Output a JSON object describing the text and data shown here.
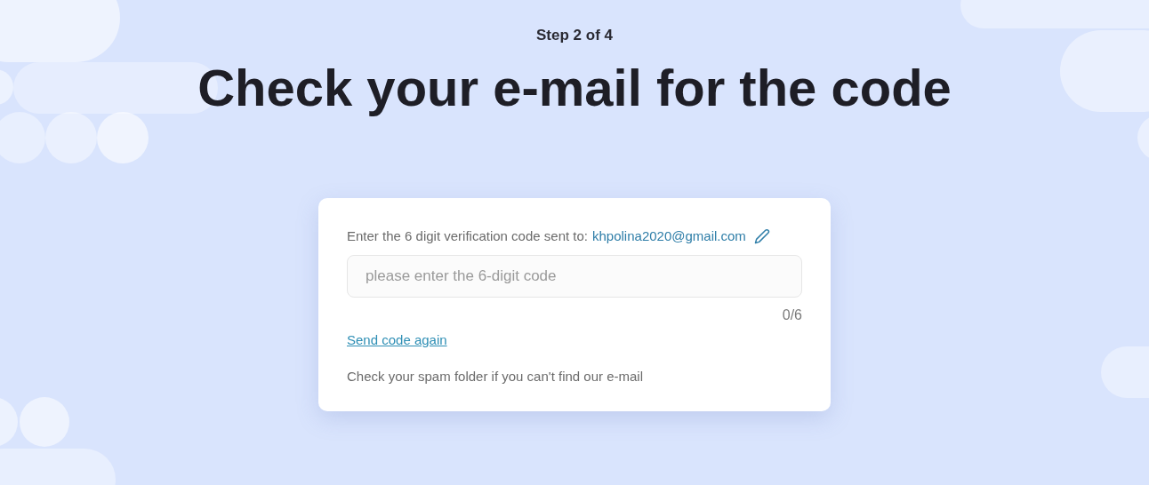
{
  "step": "Step 2 of 4",
  "title": "Check your e-mail for the code",
  "card": {
    "prompt": "Enter the 6 digit verification code sent to:",
    "email": "khpolina2020@gmail.com",
    "code_field": {
      "placeholder": "please enter the 6-digit code"
    },
    "counter": "0/6",
    "resend_link": "Send code again",
    "hint": "Check your spam folder if you can't find our e-mail"
  }
}
